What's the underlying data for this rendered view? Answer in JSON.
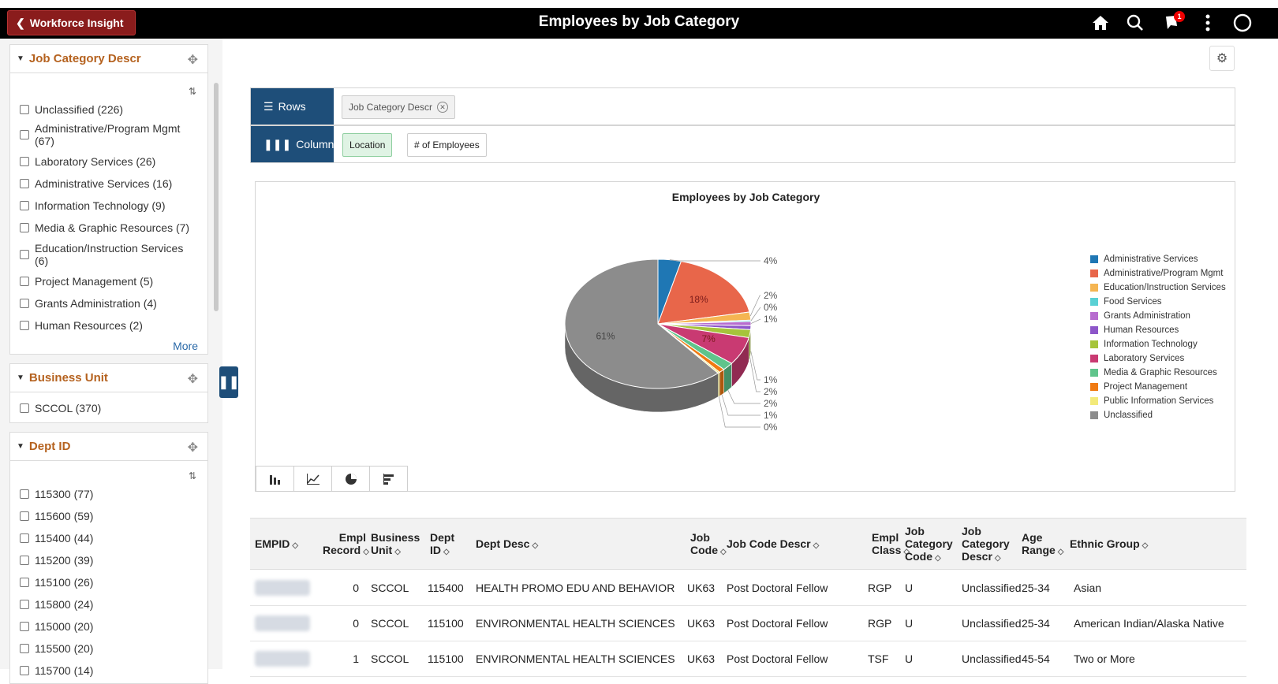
{
  "header": {
    "back_label": "Workforce Insight",
    "title": "Employees by Job Category",
    "notification_count": "1"
  },
  "facets": {
    "job_category": {
      "title": "Job Category Descr",
      "options": [
        "Unclassified (226)",
        "Administrative/Program Mgmt (67)",
        "Laboratory Services (26)",
        "Administrative Services (16)",
        "Information Technology (9)",
        "Media & Graphic Resources (7)",
        "Education/Instruction Services (6)",
        "Project Management (5)",
        "Grants Administration (4)",
        "Human Resources (2)"
      ],
      "more_label": "More"
    },
    "business_unit": {
      "title": "Business Unit",
      "options": [
        "SCCOL (370)"
      ]
    },
    "dept_id": {
      "title": "Dept ID",
      "options": [
        "115300 (77)",
        "115600 (59)",
        "115400 (44)",
        "115200 (39)",
        "115100 (26)",
        "115800 (24)",
        "115000 (20)",
        "115500 (20)",
        "115700 (14)"
      ]
    }
  },
  "pivot": {
    "rows_label": "Rows",
    "columns_label": "Columns",
    "row_chip": "Job Category Descr",
    "column_chips": [
      "Location",
      "# of Employees"
    ]
  },
  "chart_data": {
    "type": "pie",
    "title": "Employees by Job Category",
    "slices": [
      {
        "label": "Administrative Services",
        "percent": 4,
        "color": "#1f77b4"
      },
      {
        "label": "Administrative/Program Mgmt",
        "percent": 18,
        "color": "#e8664a"
      },
      {
        "label": "Education/Instruction Services",
        "percent": 2,
        "color": "#f5b552"
      },
      {
        "label": "Food Services",
        "percent": 0,
        "color": "#59d0d4"
      },
      {
        "label": "Grants Administration",
        "percent": 1,
        "color": "#b76ccf"
      },
      {
        "label": "Human Resources",
        "percent": 1,
        "color": "#8d56c9"
      },
      {
        "label": "Information Technology",
        "percent": 2,
        "color": "#a6c43b"
      },
      {
        "label": "Laboratory Services",
        "percent": 7,
        "color": "#c93a72"
      },
      {
        "label": "Media & Graphic Resources",
        "percent": 2,
        "color": "#5fc48b"
      },
      {
        "label": "Project Management",
        "percent": 1,
        "color": "#f07a12"
      },
      {
        "label": "Public Information Services",
        "percent": 0,
        "color": "#f3ea7a"
      },
      {
        "label": "Unclassified",
        "percent": 61,
        "color": "#8c8c8c"
      }
    ]
  },
  "table": {
    "headers": [
      {
        "lines": [
          "EMPID"
        ]
      },
      {
        "lines": [
          "Empl",
          "Record"
        ]
      },
      {
        "lines": [
          "Business",
          "Unit"
        ]
      },
      {
        "lines": [
          "Dept",
          "ID"
        ]
      },
      {
        "lines": [
          "Dept Desc"
        ]
      },
      {
        "lines": [
          "Job",
          "Code"
        ]
      },
      {
        "lines": [
          "Job Code Descr"
        ]
      },
      {
        "lines": [
          "Empl",
          "Class"
        ]
      },
      {
        "lines": [
          "Job",
          "Category",
          "Code"
        ]
      },
      {
        "lines": [
          "Job",
          "Category",
          "Descr"
        ]
      },
      {
        "lines": [
          "Age",
          "Range"
        ]
      },
      {
        "lines": [
          "Ethnic Group"
        ]
      }
    ],
    "rows": [
      {
        "empl_record": "0",
        "bu": "SCCOL",
        "dept_id": "115400",
        "dept_desc": "HEALTH PROMO EDU AND BEHAVIOR",
        "job_code": "UK63",
        "job_descr": "Post Doctoral Fellow",
        "empl_class": "RGP",
        "cat_code": "U",
        "cat_descr": "Unclassified",
        "age": "25-34",
        "ethnic": "Asian"
      },
      {
        "empl_record": "0",
        "bu": "SCCOL",
        "dept_id": "115100",
        "dept_desc": "ENVIRONMENTAL HEALTH SCIENCES",
        "job_code": "UK63",
        "job_descr": "Post Doctoral Fellow",
        "empl_class": "RGP",
        "cat_code": "U",
        "cat_descr": "Unclassified",
        "age": "25-34",
        "ethnic": "American Indian/Alaska Native"
      },
      {
        "empl_record": "1",
        "bu": "SCCOL",
        "dept_id": "115100",
        "dept_desc": "ENVIRONMENTAL HEALTH SCIENCES",
        "job_code": "UK63",
        "job_descr": "Post Doctoral Fellow",
        "empl_class": "TSF",
        "cat_code": "U",
        "cat_descr": "Unclassified",
        "age": "45-54",
        "ethnic": "Two or More"
      }
    ]
  }
}
